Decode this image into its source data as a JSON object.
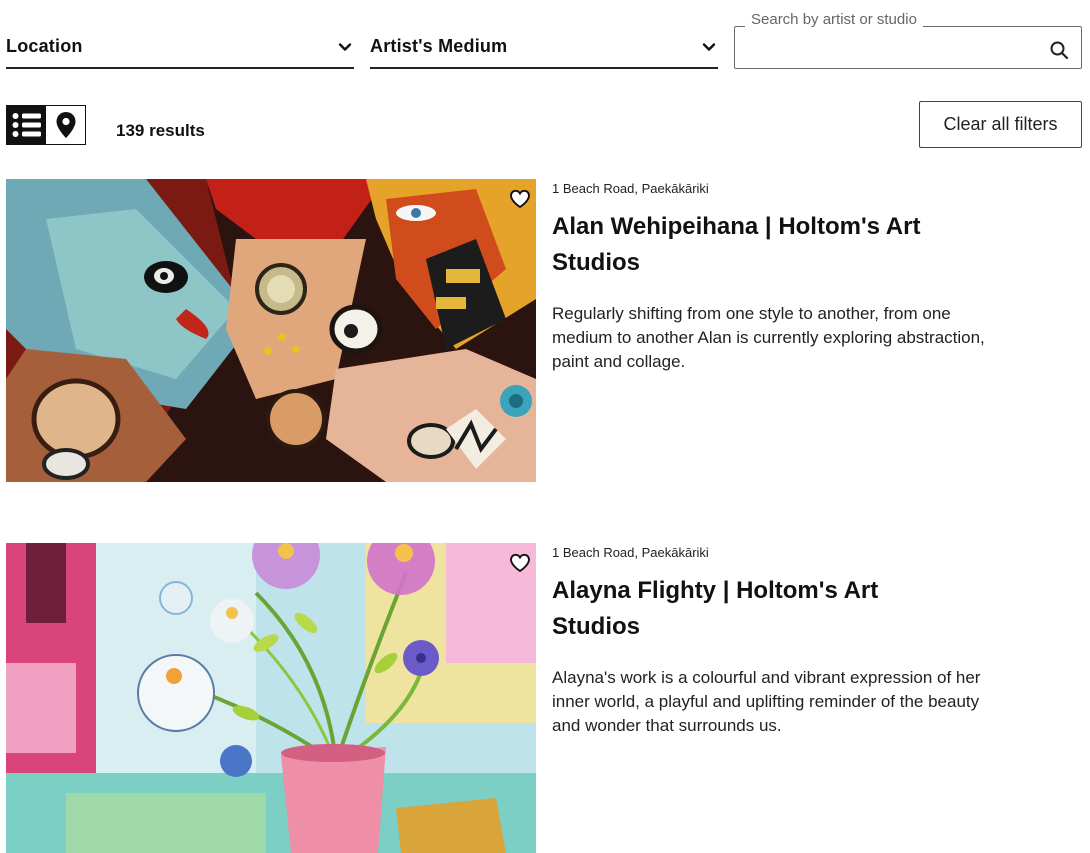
{
  "filters": {
    "location_label": "Location",
    "medium_label": "Artist's Medium",
    "search_legend": "Search by artist or studio",
    "search_value": ""
  },
  "toolbar": {
    "results_text": "139 results",
    "clear_label": "Clear all filters",
    "active_view": "list"
  },
  "icons": {
    "chevron": "chevron-down-icon",
    "search": "search-icon",
    "list_view": "list-icon",
    "map_view": "map-pin-icon",
    "favourite": "heart-icon"
  },
  "listings": [
    {
      "address": "1 Beach Road, Paekākāriki",
      "title": "Alan Wehipeihana | Holtom's Art Studios",
      "description": "Regularly shifting from one style to another, from one medium to another Alan is currently exploring abstraction, paint and collage."
    },
    {
      "address": "1 Beach Road, Paekākāriki",
      "title": "Alayna Flighty | Holtom's Art Studios",
      "description": "Alayna's work is a colourful and vibrant expression of her inner world, a playful and uplifting reminder of the beauty and wonder that surrounds us."
    }
  ]
}
